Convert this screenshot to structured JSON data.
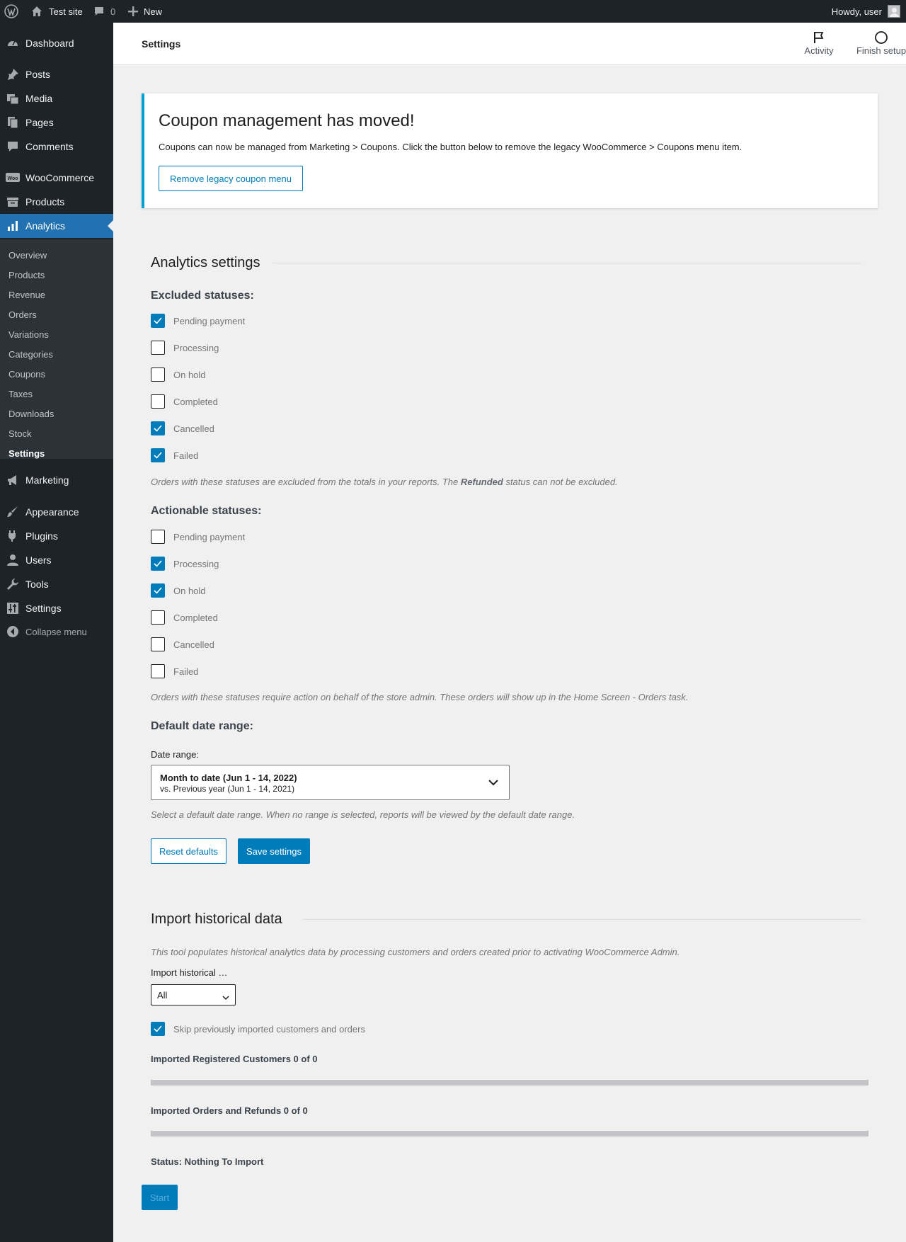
{
  "adminbar": {
    "site_name": "Test site",
    "comments_count": "0",
    "new_label": "New",
    "howdy": "Howdy, user"
  },
  "sidebar": {
    "items": [
      {
        "label": "Dashboard",
        "icon": "dashboard-icon"
      },
      {
        "label": "Posts",
        "icon": "pushpin-icon"
      },
      {
        "label": "Media",
        "icon": "media-icon"
      },
      {
        "label": "Pages",
        "icon": "pages-icon"
      },
      {
        "label": "Comments",
        "icon": "comment-icon"
      },
      {
        "label": "WooCommerce",
        "icon": "woo-icon"
      },
      {
        "label": "Products",
        "icon": "archive-icon"
      },
      {
        "label": "Analytics",
        "icon": "bar-chart-icon"
      },
      {
        "label": "Marketing",
        "icon": "megaphone-icon"
      },
      {
        "label": "Appearance",
        "icon": "paintbrush-icon"
      },
      {
        "label": "Plugins",
        "icon": "plug-icon"
      },
      {
        "label": "Users",
        "icon": "user-icon"
      },
      {
        "label": "Tools",
        "icon": "wrench-icon"
      },
      {
        "label": "Settings",
        "icon": "sliders-icon"
      },
      {
        "label": "Collapse menu",
        "icon": "collapse-icon"
      }
    ],
    "submenu": [
      "Overview",
      "Products",
      "Revenue",
      "Orders",
      "Variations",
      "Categories",
      "Coupons",
      "Taxes",
      "Downloads",
      "Stock",
      "Settings"
    ]
  },
  "header": {
    "title": "Settings",
    "activity_label": "Activity",
    "finish_setup_label": "Finish setup"
  },
  "notice": {
    "title": "Coupon management has moved!",
    "body": "Coupons can now be managed from Marketing > Coupons. Click the button below to remove the legacy WooCommerce > Coupons menu item.",
    "button_label": "Remove legacy coupon menu"
  },
  "analytics": {
    "title": "Analytics settings",
    "excluded": {
      "title": "Excluded statuses:",
      "options": [
        {
          "label": "Pending payment",
          "checked": true
        },
        {
          "label": "Processing",
          "checked": false
        },
        {
          "label": "On hold",
          "checked": false
        },
        {
          "label": "Completed",
          "checked": false
        },
        {
          "label": "Cancelled",
          "checked": true
        },
        {
          "label": "Failed",
          "checked": true
        }
      ],
      "help_before": "Orders with these statuses are excluded from the totals in your reports. The ",
      "help_bold": "Refunded",
      "help_after": " status can not be excluded."
    },
    "actionable": {
      "title": "Actionable statuses:",
      "options": [
        {
          "label": "Pending payment",
          "checked": false
        },
        {
          "label": "Processing",
          "checked": true
        },
        {
          "label": "On hold",
          "checked": true
        },
        {
          "label": "Completed",
          "checked": false
        },
        {
          "label": "Cancelled",
          "checked": false
        },
        {
          "label": "Failed",
          "checked": false
        }
      ],
      "help": "Orders with these statuses require action on behalf of the store admin. These orders will show up in the Home Screen - Orders task."
    },
    "date_range": {
      "title": "Default date range:",
      "label": "Date range:",
      "primary": "Month to date (Jun 1 - 14, 2022)",
      "secondary": "vs. Previous year (Jun 1 - 14, 2021)",
      "help": "Select a default date range. When no range is selected, reports will be viewed by the default date range."
    },
    "reset_label": "Reset defaults",
    "save_label": "Save settings"
  },
  "import": {
    "title": "Import historical data",
    "description": "This tool populates historical analytics data by processing customers and orders created prior to activating WooCommerce Admin.",
    "select_label": "Import historical …",
    "select_value": "All",
    "skip_label": "Skip previously imported customers and orders",
    "skip_checked": true,
    "customers_label": "Imported Registered Customers 0 of 0",
    "customers_progress": 0,
    "orders_label": "Imported Orders and Refunds 0 of 0",
    "orders_progress": 0,
    "status": "Status: Nothing To Import",
    "start_label": "Start"
  },
  "colors": {
    "admin_dark": "#1d2327",
    "accent": "#2271b1",
    "primary": "#007cba",
    "notice_border": "#00a0d2"
  }
}
